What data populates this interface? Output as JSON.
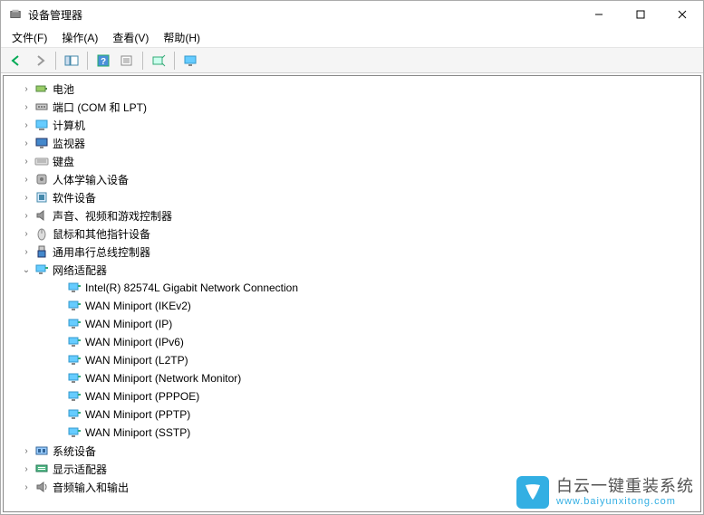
{
  "window": {
    "title": "设备管理器"
  },
  "menu": {
    "file": "文件(F)",
    "action": "操作(A)",
    "view": "查看(V)",
    "help": "帮助(H)"
  },
  "toolbar_icons": {
    "back": "back-icon",
    "forward": "forward-icon",
    "show_hide": "show-hide-icon",
    "help": "help-icon",
    "properties": "properties-icon",
    "scan": "scan-icon",
    "monitor": "monitor-icon"
  },
  "tree": {
    "level1": [
      {
        "icon": "battery",
        "label": "电池",
        "expanded": false
      },
      {
        "icon": "port",
        "label": "端口 (COM 和 LPT)",
        "expanded": false
      },
      {
        "icon": "computer",
        "label": "计算机",
        "expanded": false
      },
      {
        "icon": "monitor",
        "label": "监视器",
        "expanded": false
      },
      {
        "icon": "keyboard",
        "label": "键盘",
        "expanded": false
      },
      {
        "icon": "hid",
        "label": "人体学输入设备",
        "expanded": false
      },
      {
        "icon": "software",
        "label": "软件设备",
        "expanded": false
      },
      {
        "icon": "sound",
        "label": "声音、视频和游戏控制器",
        "expanded": false
      },
      {
        "icon": "mouse",
        "label": "鼠标和其他指针设备",
        "expanded": false
      },
      {
        "icon": "usb",
        "label": "通用串行总线控制器",
        "expanded": false
      },
      {
        "icon": "network",
        "label": "网络适配器",
        "expanded": true,
        "children": [
          {
            "icon": "nic",
            "label": "Intel(R) 82574L Gigabit Network Connection"
          },
          {
            "icon": "nic",
            "label": "WAN Miniport (IKEv2)"
          },
          {
            "icon": "nic",
            "label": "WAN Miniport (IP)"
          },
          {
            "icon": "nic",
            "label": "WAN Miniport (IPv6)"
          },
          {
            "icon": "nic",
            "label": "WAN Miniport (L2TP)"
          },
          {
            "icon": "nic",
            "label": "WAN Miniport (Network Monitor)"
          },
          {
            "icon": "nic",
            "label": "WAN Miniport (PPPOE)"
          },
          {
            "icon": "nic",
            "label": "WAN Miniport (PPTP)"
          },
          {
            "icon": "nic",
            "label": "WAN Miniport (SSTP)"
          }
        ]
      },
      {
        "icon": "system",
        "label": "系统设备",
        "expanded": false
      },
      {
        "icon": "display",
        "label": "显示适配器",
        "expanded": false
      },
      {
        "icon": "audio",
        "label": "音频输入和输出",
        "expanded": false
      }
    ]
  },
  "watermark": {
    "top": "白云一键重装系统",
    "bottom": "www.baiyunxitong.com"
  }
}
